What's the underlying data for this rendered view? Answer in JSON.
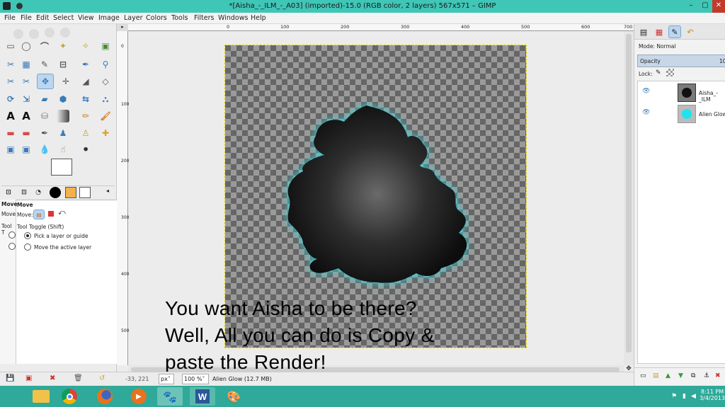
{
  "window": {
    "title": "*[Aisha_-_ILM_-_A03] (imported)-15.0 (RGB color, 2 layers) 567x571 – GIMP"
  },
  "menubar": {
    "items": [
      "File",
      "File",
      "Edit",
      "Select",
      "View",
      "Image",
      "Layer",
      "Colors",
      "Tools",
      "Filters",
      "Windows",
      "Help"
    ]
  },
  "toolbox": {
    "tools": [
      "rect-select",
      "ellipse-select",
      "free-select",
      "fuzzy-select",
      "color-select",
      "scissors",
      "foreground-select",
      "paths",
      "color-picker",
      "zoom",
      "measure",
      "move",
      "align",
      "crop",
      "rotate",
      "scale",
      "shear",
      "perspective",
      "flip",
      "cage",
      "text",
      "text-2",
      "bucket-fill",
      "blend",
      "pencil",
      "paintbrush",
      "eraser",
      "airbrush",
      "ink",
      "clone",
      "heal",
      "smudge",
      "dodge-burn"
    ],
    "active_tool": "move"
  },
  "tool_options": {
    "tab_label": "Move",
    "tab_label_partial": "Move",
    "move_label": "Move:",
    "move_label_partial": "Move",
    "toggle_label": "Tool Toggle  (Shift)",
    "toggle_label_partial": "Tool T",
    "options": [
      "Pick a layer or guide",
      "Move the active layer"
    ],
    "selected_option": "Pick a layer or guide"
  },
  "ruler": {
    "labels": [
      "0",
      "100",
      "200",
      "300",
      "400",
      "500",
      "600",
      "700"
    ],
    "vlabels": [
      "0",
      "100",
      "200",
      "300",
      "400",
      "500"
    ]
  },
  "canvas": {
    "overlay_text": [
      "You want Aisha to be there?",
      "Well, All you can do is Copy &",
      "paste the Render!"
    ],
    "glow_color": "#1ee4ee"
  },
  "status": {
    "coords": "-33, 221",
    "unit": "px",
    "zoom": "100 %",
    "info": "Alien Glow (12.7 MB)"
  },
  "layers": {
    "mode_label": "Mode: Normal",
    "opacity_label": "Opacity",
    "opacity_value": "10",
    "lock_label": "Lock:",
    "items": [
      {
        "name": "Aisha_-_ILM",
        "visible": true
      },
      {
        "name": "Alien Glow",
        "visible": true
      }
    ]
  },
  "taskbar": {
    "apps": [
      "file-explorer",
      "chrome",
      "firefox",
      "media-player",
      "gimp",
      "word",
      "paint"
    ],
    "time": "8:11 PM",
    "date": "3/4/2013"
  },
  "colors": {
    "accent": "#3fc6b6",
    "taskbar": "#2fa999",
    "selection": "#bcd6ef"
  }
}
